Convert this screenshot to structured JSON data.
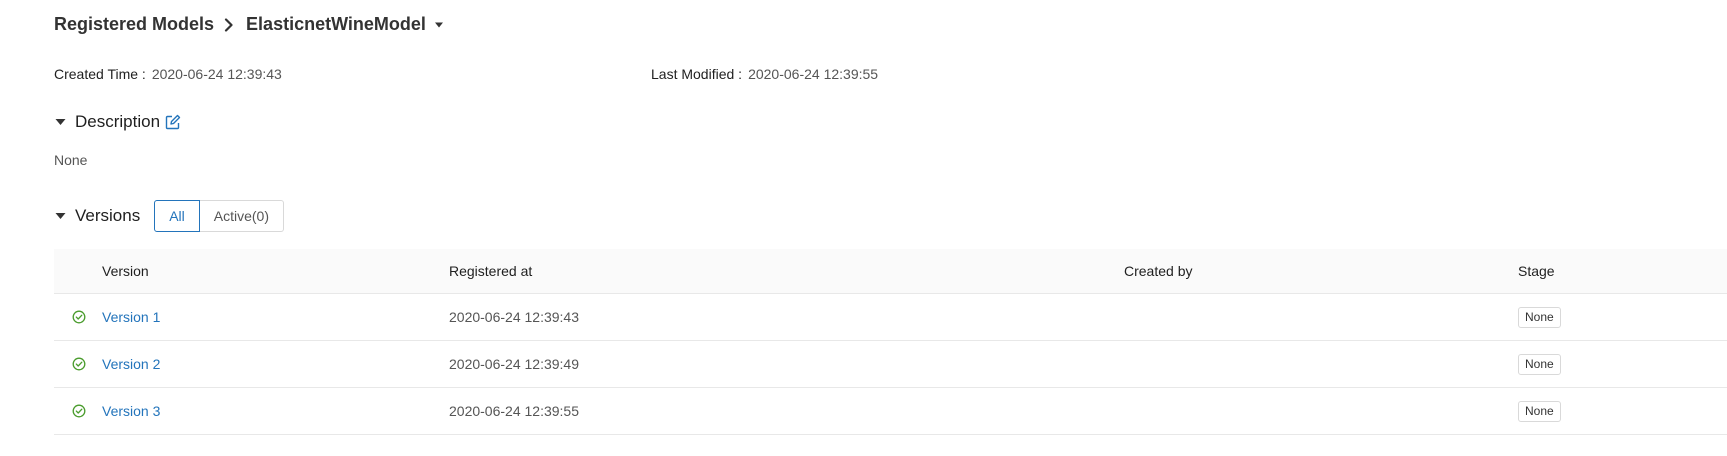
{
  "breadcrumb": {
    "parent": "Registered Models",
    "current": "ElasticnetWineModel"
  },
  "meta": {
    "created_label": "Created Time :",
    "created_value": "2020-06-24 12:39:43",
    "modified_label": "Last Modified :",
    "modified_value": "2020-06-24 12:39:55"
  },
  "description": {
    "title": "Description",
    "body": "None"
  },
  "versions": {
    "title": "Versions",
    "filter_all": "All",
    "filter_active": "Active(0)",
    "columns": {
      "version": "Version",
      "registered_at": "Registered at",
      "created_by": "Created by",
      "stage": "Stage"
    },
    "rows": [
      {
        "version": "Version 1",
        "registered_at": "2020-06-24 12:39:43",
        "created_by": "",
        "stage": "None"
      },
      {
        "version": "Version 2",
        "registered_at": "2020-06-24 12:39:49",
        "created_by": "",
        "stage": "None"
      },
      {
        "version": "Version 3",
        "registered_at": "2020-06-24 12:39:55",
        "created_by": "",
        "stage": "None"
      }
    ]
  },
  "colors": {
    "link": "#2374bb",
    "ready": "#4a9c2d",
    "border": "#e8e8e8"
  },
  "icons": {
    "breadcrumb_separator": "chevron-right-icon",
    "model_dropdown": "caret-down-icon",
    "section_toggle": "caret-down-icon",
    "edit": "edit-icon",
    "version_status": "check-circle-icon"
  }
}
